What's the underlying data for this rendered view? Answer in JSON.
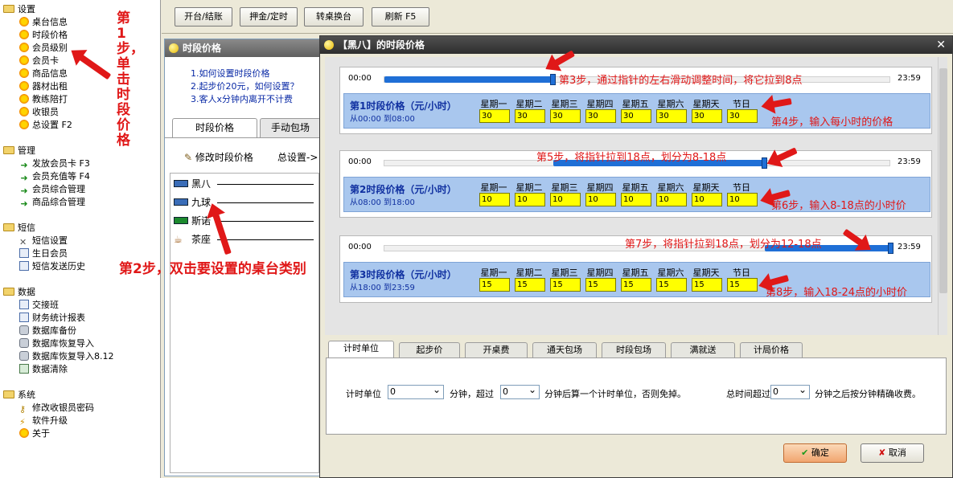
{
  "tree": {
    "settings": {
      "label": "设置",
      "items": [
        "桌台信息",
        "时段价格",
        "会员级别",
        "会员卡",
        "商品信息",
        "器材出租",
        "教练陪打",
        "收银员",
        "总设置 F2"
      ]
    },
    "manage": {
      "label": "管理",
      "items": [
        "发放会员卡 F3",
        "会员充值等 F4",
        "会员综合管理",
        "商品综合管理"
      ]
    },
    "sms": {
      "label": "短信",
      "items": [
        "短信设置",
        "生日会员",
        "短信发送历史"
      ]
    },
    "data": {
      "label": "数据",
      "items": [
        "交接班",
        "财务统计报表",
        "数据库备份",
        "数据库恢复导入",
        "数据库恢复导入8.12",
        "数据清除"
      ]
    },
    "system": {
      "label": "系统",
      "items": [
        "修改收银员密码",
        "软件升级",
        "关于"
      ]
    }
  },
  "toolbar": {
    "b1": "开台/结账",
    "b2": "押金/定时",
    "b3": "转桌换台",
    "b4": "刷新 F5"
  },
  "backwin": {
    "title": "时段价格",
    "help": [
      "1.如何设置时段价格",
      "2.起步价20元，如何设置？",
      "3.客人x分钟内离开不计费"
    ],
    "tabs": [
      "时段价格",
      "手动包场"
    ],
    "edit_btn": "修改时段价格",
    "total_settings": "总设置->",
    "tables": [
      "黑八",
      "九球",
      "斯诺",
      "茶座"
    ]
  },
  "dialog": {
    "title": "【黑八】的时段价格",
    "start_label": "00:00",
    "end_label": "23:59",
    "days": [
      "星期一",
      "星期二",
      "星期三",
      "星期四",
      "星期五",
      "星期六",
      "星期天",
      "节日"
    ],
    "periods": [
      {
        "title": "第1时段价格（元/小时）",
        "range": "从00:00 到08:00",
        "prices": [
          "30",
          "30",
          "30",
          "30",
          "30",
          "30",
          "30",
          "30"
        ],
        "from": 0,
        "to": 0.333
      },
      {
        "title": "第2时段价格（元/小时）",
        "range": "从08:00 到18:00",
        "prices": [
          "10",
          "10",
          "10",
          "10",
          "10",
          "10",
          "10",
          "10"
        ],
        "from": 0.333,
        "to": 0.75
      },
      {
        "title": "第3时段价格（元/小时）",
        "range": "从18:00 到23:59",
        "prices": [
          "15",
          "15",
          "15",
          "15",
          "15",
          "15",
          "15",
          "15"
        ],
        "from": 0.75,
        "to": 1
      }
    ],
    "bottom_tabs": [
      "计时单位",
      "起步价",
      "开桌费",
      "通天包场",
      "时段包场",
      "满就送",
      "计局价格"
    ],
    "unit_label": "计时单位",
    "unit_value": "0",
    "min_over": "分钟，超过",
    "over_value": "0",
    "min_tail": "分钟后算一个计时单位，否则免掉。",
    "total_label": "总时间超过",
    "total_value": "0",
    "total_tail": "分钟之后按分钟精确收费。",
    "ok": "确定",
    "cancel": "取消"
  },
  "annotations": {
    "step1": "第1步，单击时段价格",
    "step2": "第2步，双击要设置的桌台类别",
    "step3": "第3步，通过指针的左右滑动调整时间，将它拉到8点",
    "step4": "第4步，输入每小时的价格",
    "step5": "第5步，将指针拉到18点，划分为8-18点",
    "step6": "第6步，输入8-18点的小时价",
    "step7": "第7步，将指针拉到18点，划分为12-18点",
    "step8": "第8步，输入18-24点的小时价"
  }
}
